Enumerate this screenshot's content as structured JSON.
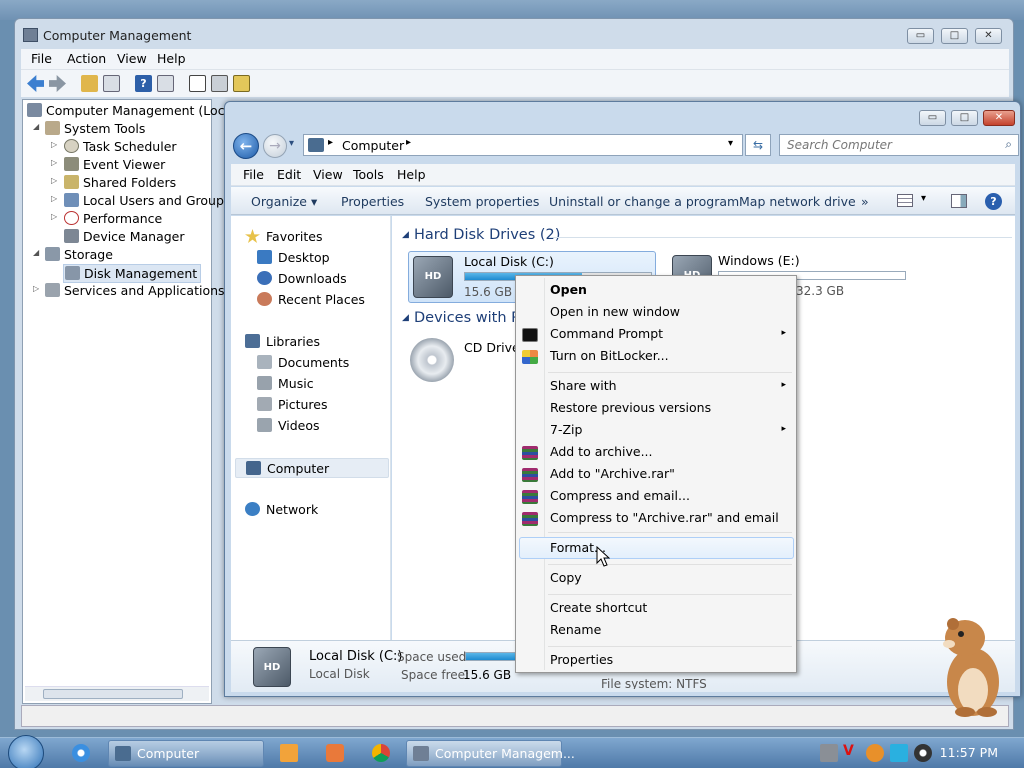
{
  "cm": {
    "title": "Computer Management",
    "caption_buttons": [
      "▭",
      "□",
      "✕"
    ],
    "menu": [
      "File",
      "Action",
      "View",
      "Help"
    ],
    "tree": [
      {
        "label": "Computer Management (Local",
        "level": 0,
        "arrow": "",
        "icon": "computer-management-icon"
      },
      {
        "label": "System Tools",
        "level": 1,
        "arrow": "◢",
        "icon": "tools-icon"
      },
      {
        "label": "Task Scheduler",
        "level": 2,
        "arrow": "▷",
        "icon": "clock-icon"
      },
      {
        "label": "Event Viewer",
        "level": 2,
        "arrow": "▷",
        "icon": "event-viewer-icon"
      },
      {
        "label": "Shared Folders",
        "level": 2,
        "arrow": "▷",
        "icon": "shared-folders-icon"
      },
      {
        "label": "Local Users and Groups",
        "level": 2,
        "arrow": "▷",
        "icon": "users-icon"
      },
      {
        "label": "Performance",
        "level": 2,
        "arrow": "▷",
        "icon": "performance-icon"
      },
      {
        "label": "Device Manager",
        "level": 2,
        "arrow": "",
        "icon": "device-manager-icon"
      },
      {
        "label": "Storage",
        "level": 1,
        "arrow": "◢",
        "icon": "storage-icon"
      },
      {
        "label": "Disk Management",
        "level": 2,
        "arrow": "",
        "icon": "disk-management-icon",
        "selected": true
      },
      {
        "label": "Services and Applications",
        "level": 1,
        "arrow": "▷",
        "icon": "services-icon"
      }
    ]
  },
  "explorer": {
    "caption_buttons": [
      "▭",
      "□",
      "✕"
    ],
    "address": {
      "path": "Computer",
      "sep1": "▸",
      "sep2": "▸",
      "dropdown": "▾"
    },
    "search_placeholder": "Search Computer",
    "menu": [
      "File",
      "Edit",
      "View",
      "Tools",
      "Help"
    ],
    "commands": [
      "Organize ▾",
      "Properties",
      "System properties",
      "Uninstall or change a program",
      "Map network drive",
      "»"
    ],
    "nav": {
      "favorites_header": "Favorites",
      "favorites": [
        "Desktop",
        "Downloads",
        "Recent Places"
      ],
      "libraries_header": "Libraries",
      "libraries": [
        "Documents",
        "Music",
        "Pictures",
        "Videos"
      ],
      "computer": "Computer",
      "network": "Network"
    },
    "hdd_group": "Hard Disk Drives (2)",
    "drive_c": {
      "name": "Local Disk (C:)",
      "free_text": "15.6 GB fr",
      "used_fraction": 0.63
    },
    "drive_e": {
      "name": "Windows (E:)",
      "free_text": "32.3 GB",
      "used_fraction": 0.0
    },
    "devices_group": "Devices with Re",
    "cd_drive": "CD Drive (",
    "details": {
      "name": "Local Disk (C:)",
      "type": "Local Disk",
      "space_used_label": "Space used:",
      "space_free_label": "Space free:",
      "space_free_value": "15.6 GB",
      "filesystem_partial": "File system: NTFS"
    }
  },
  "context_menu": {
    "items": [
      {
        "label": "Open",
        "bold": true,
        "icon": "",
        "submenu": false
      },
      {
        "label": "Open in new window",
        "icon": "",
        "submenu": false
      },
      {
        "label": "Command Prompt",
        "icon": "cmd-icon",
        "submenu": true
      },
      {
        "label": "Turn on BitLocker...",
        "icon": "bitlocker-icon",
        "submenu": false
      },
      {
        "label": "Share with",
        "icon": "",
        "submenu": true
      },
      {
        "label": "Restore previous versions",
        "icon": "",
        "submenu": false
      },
      {
        "label": "7-Zip",
        "icon": "",
        "submenu": true
      },
      {
        "label": "Add to archive...",
        "icon": "winrar-icon",
        "submenu": false
      },
      {
        "label": "Add to \"Archive.rar\"",
        "icon": "winrar-icon",
        "submenu": false
      },
      {
        "label": "Compress and email...",
        "icon": "winrar-icon",
        "submenu": false
      },
      {
        "label": "Compress to \"Archive.rar\" and email",
        "icon": "winrar-icon",
        "submenu": false
      },
      {
        "label": "Format...",
        "icon": "",
        "submenu": false,
        "hovered": true
      },
      {
        "label": "Copy",
        "icon": "",
        "submenu": false
      },
      {
        "label": "Create shortcut",
        "icon": "",
        "submenu": false
      },
      {
        "label": "Rename",
        "icon": "",
        "submenu": false
      },
      {
        "label": "Properties",
        "icon": "",
        "submenu": false
      }
    ],
    "submenu_arrow": "▸"
  },
  "taskbar": {
    "buttons": [
      {
        "label": "Computer",
        "icon": "explorer-icon"
      },
      {
        "label": "Computer Managem...",
        "icon": "computer-management-icon"
      }
    ],
    "clock": "11:57 PM"
  },
  "colors": {
    "accent": "#1e3f78",
    "selection": "#cfe3f8",
    "taskbar": "#4f79a8"
  }
}
